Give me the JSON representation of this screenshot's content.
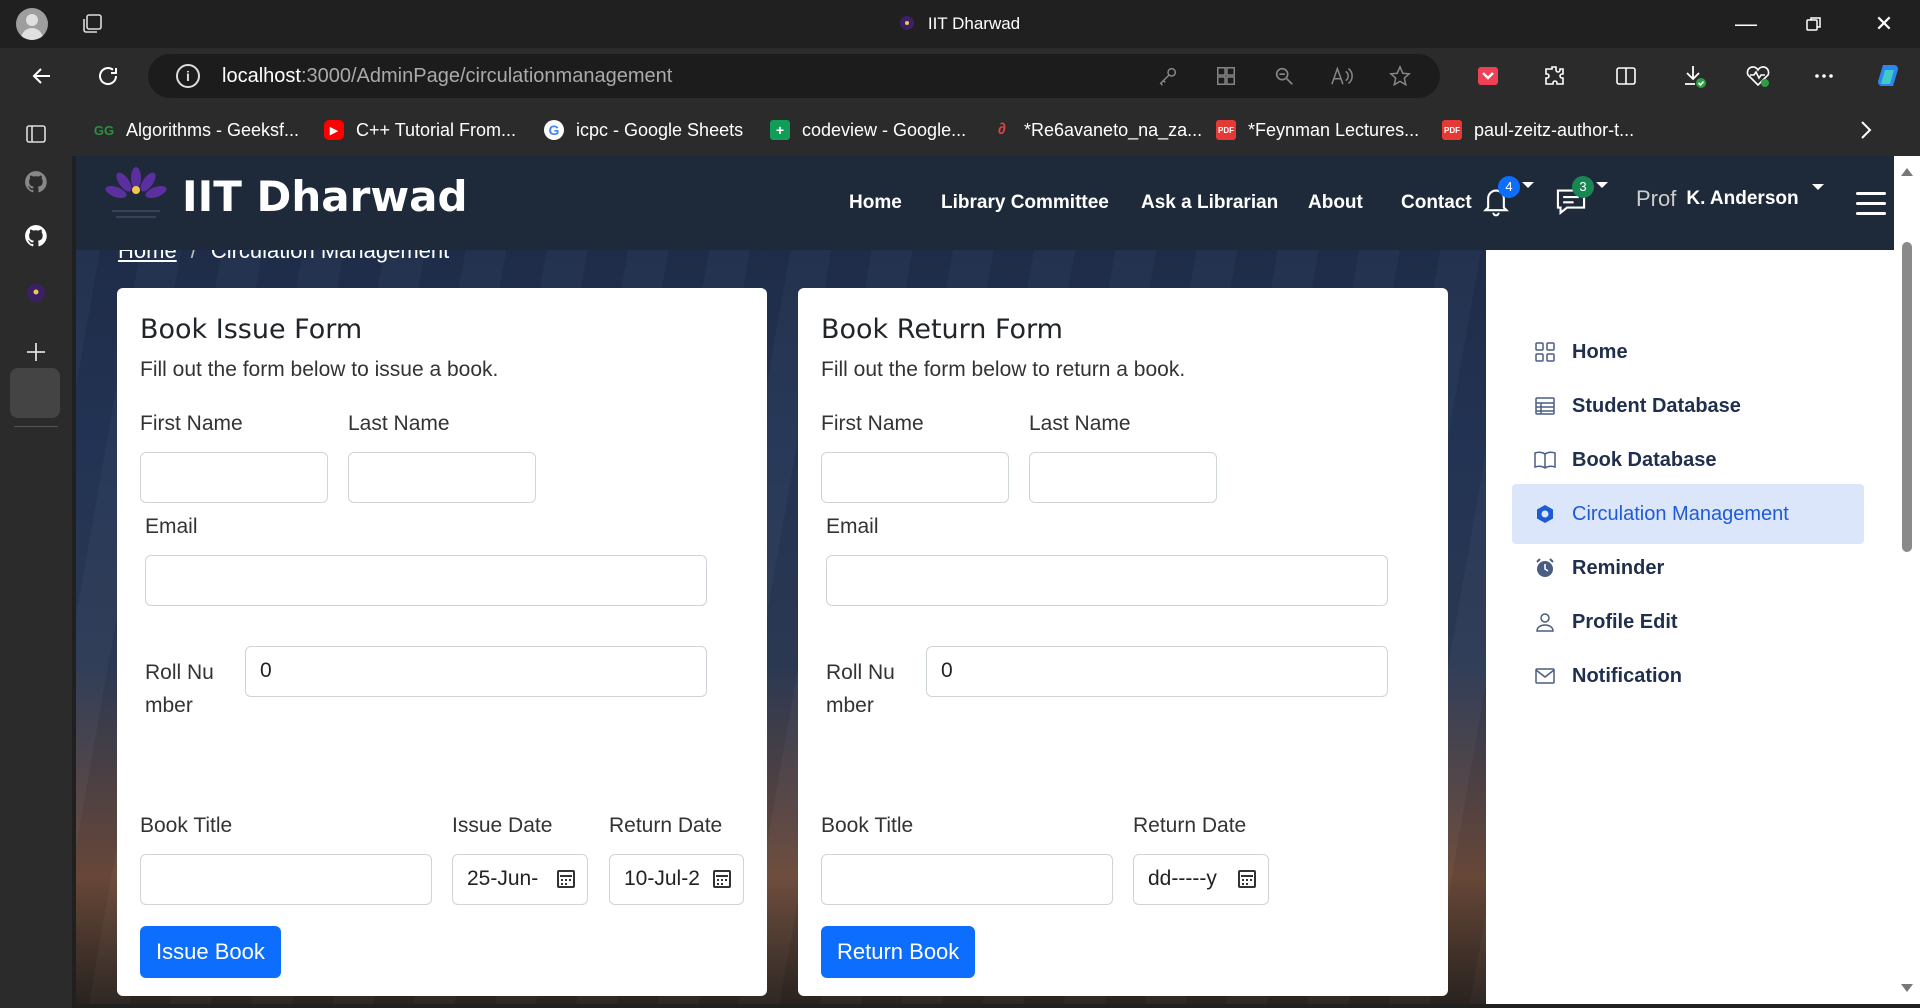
{
  "browser": {
    "tab_title": "IIT Dharwad",
    "url_host": "localhost",
    "url_rest": ":3000/AdminPage/circulationmanagement",
    "bookmarks": [
      {
        "label": "Algorithms - Geeksf...",
        "icon": "geeksforgeeks-icon",
        "color": "#2f8d46"
      },
      {
        "label": "C++ Tutorial From...",
        "icon": "youtube-icon",
        "color": "#ff0000"
      },
      {
        "label": "icpc - Google Sheets",
        "icon": "google-icon",
        "color": "#ffffff"
      },
      {
        "label": "codeview - Google...",
        "icon": "google-sheets-icon",
        "color": "#0f9d58"
      },
      {
        "label": "*Re6avaneto_na_za...",
        "icon": "link-icon",
        "color": "#d44"
      },
      {
        "label": "*Feynman Lectures...",
        "icon": "pdf-icon",
        "color": "#e53935"
      },
      {
        "label": "paul-zeitz-author-t...",
        "icon": "pdf-icon",
        "color": "#e53935"
      }
    ]
  },
  "navbar": {
    "brand": "IIT Dharwad",
    "links": [
      "Home",
      "Library Committee",
      "Ask a Librarian",
      "About",
      "Contact"
    ],
    "notification_count": "4",
    "message_count": "3",
    "profile_img_alt": "Prof",
    "user_name": "K. Anderson"
  },
  "breadcrumb": {
    "home": "Home",
    "current": "Circulation Management"
  },
  "issue_form": {
    "title": "Book Issue Form",
    "subtitle": "Fill out the form below to issue a book.",
    "first_name_label": "First Name",
    "last_name_label": "Last Name",
    "email_label": "Email",
    "roll_label": "Roll Number",
    "roll_value": "0",
    "book_title_label": "Book Title",
    "issue_date_label": "Issue Date",
    "issue_date_value": "25-Jun-",
    "return_date_label": "Return Date",
    "return_date_value": "10-Jul-2",
    "button": "Issue Book"
  },
  "return_form": {
    "title": "Book Return Form",
    "subtitle": "Fill out the form below to return a book.",
    "first_name_label": "First Name",
    "last_name_label": "Last Name",
    "email_label": "Email",
    "roll_label": "Roll Number",
    "roll_value": "0",
    "book_title_label": "Book Title",
    "return_date_label": "Return Date",
    "return_date_value": "dd-----y",
    "button": "Return Book"
  },
  "menu": {
    "items": [
      {
        "label": "Home",
        "icon": "grid-icon",
        "active": false
      },
      {
        "label": "Student Database",
        "icon": "table-icon",
        "active": false
      },
      {
        "label": "Book Database",
        "icon": "book-open-icon",
        "active": false
      },
      {
        "label": "Circulation Management",
        "icon": "circulation-icon",
        "active": true
      },
      {
        "label": "Reminder",
        "icon": "alarm-clock-icon",
        "active": false
      },
      {
        "label": "Profile Edit",
        "icon": "person-icon",
        "active": false
      },
      {
        "label": "Notification",
        "icon": "envelope-icon",
        "active": false
      }
    ]
  },
  "colors": {
    "primary": "#0d6efd",
    "navbar": "#1e2a3a",
    "menu_active_bg": "#dbe6fb",
    "menu_text": "#1f2f4d"
  }
}
